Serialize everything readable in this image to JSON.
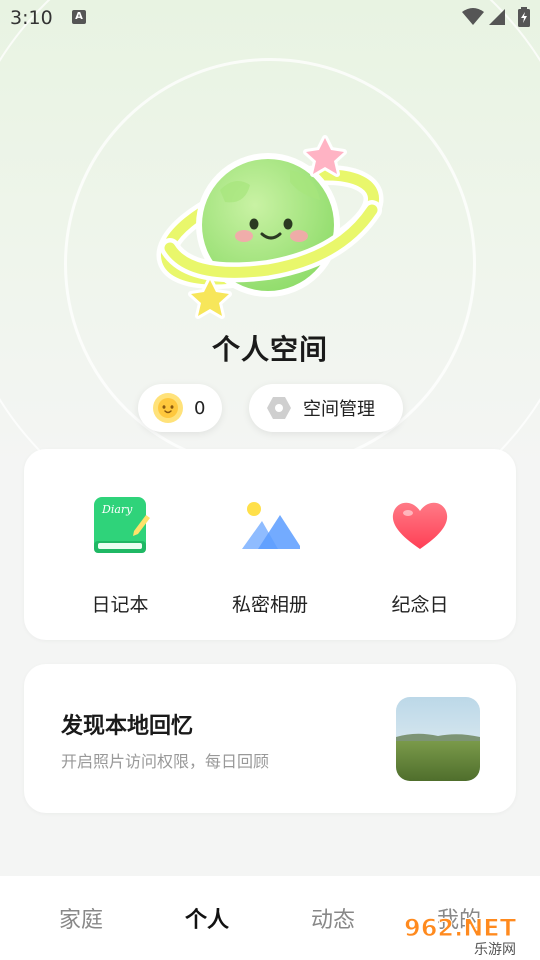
{
  "status_bar": {
    "time": "3:10",
    "notification_glyph": "A"
  },
  "header": {
    "title": "个人空间",
    "coins": "0",
    "manage_label": "空间管理"
  },
  "features": [
    {
      "label": "日记本",
      "icon": "diary-icon",
      "icon_text": "Diary"
    },
    {
      "label": "私密相册",
      "icon": "album-icon"
    },
    {
      "label": "纪念日",
      "icon": "heart-icon"
    }
  ],
  "memory_card": {
    "title": "发现本地回忆",
    "subtitle": "开启照片访问权限，每日回顾"
  },
  "bottom_nav": {
    "items": [
      {
        "label": "家庭",
        "active": false
      },
      {
        "label": "个人",
        "active": true
      },
      {
        "label": "动态",
        "active": false
      },
      {
        "label": "我的",
        "active": false
      }
    ]
  },
  "watermark": {
    "text": "962.NET",
    "sub": "乐游网"
  },
  "colors": {
    "accent_green": "#8ee06a",
    "heart_red": "#ff5a66",
    "diary_green": "#2fd37a"
  }
}
